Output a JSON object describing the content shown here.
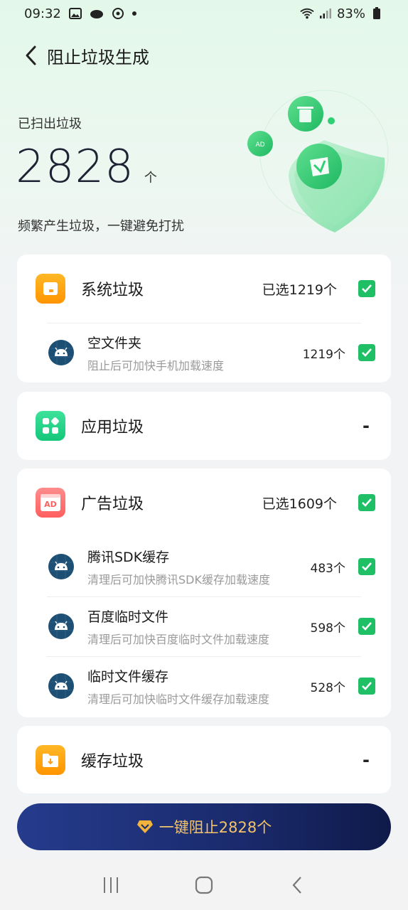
{
  "status_bar": {
    "time": "09:32",
    "battery": "83%"
  },
  "header": {
    "title": "阻止垃圾生成"
  },
  "hero": {
    "label": "已扫出垃圾",
    "count": "2828",
    "unit": "个",
    "description": "频繁产生垃圾，一键避免打扰"
  },
  "categories": {
    "system": {
      "name": "系统垃圾",
      "selected": "已选1219个",
      "items": [
        {
          "title": "空文件夹",
          "desc": "阻止后可加快手机加载速度",
          "count": "1219个"
        }
      ]
    },
    "app": {
      "name": "应用垃圾",
      "status": "-"
    },
    "ad": {
      "name": "广告垃圾",
      "selected": "已选1609个",
      "icon_text": "AD",
      "items": [
        {
          "title": "腾讯SDK缓存",
          "desc": "清理后可加快腾讯SDK缓存加载速度",
          "count": "483个"
        },
        {
          "title": "百度临时文件",
          "desc": "清理后可加快百度临时文件加载速度",
          "count": "598个"
        },
        {
          "title": "临时文件缓存",
          "desc": "清理后可加快临时文件缓存加载速度",
          "count": "528个"
        }
      ]
    },
    "cache": {
      "name": "缓存垃圾",
      "status": "-"
    }
  },
  "cta": {
    "label": "一键阻止2828个"
  },
  "colors": {
    "accent_green": "#1fbf66",
    "cta_bg": "#1a2a6c",
    "cta_text": "#f2c36b"
  },
  "icons": [
    "gallery-icon",
    "cloud-icon",
    "refresh-icon",
    "wifi-icon",
    "signal-icon",
    "battery-icon",
    "back-icon",
    "trash-icon",
    "android-icon",
    "apps-icon",
    "ad-icon",
    "folder-download-icon",
    "premium-diamond-icon",
    "nav-recents-icon",
    "nav-home-icon",
    "nav-back-icon"
  ]
}
